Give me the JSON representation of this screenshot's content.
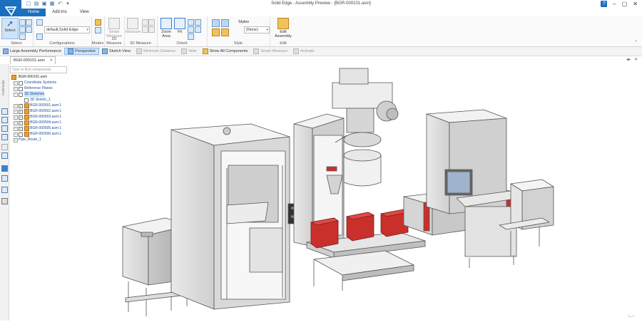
{
  "window": {
    "title": "Solid Edge - Assembly Preview - [BGR-000101.asm]"
  },
  "tabs": [
    "Home",
    "Add-Ins",
    "View"
  ],
  "ribbon": {
    "select": {
      "label": "Select",
      "group": "Select"
    },
    "configurations": {
      "value": "default,Solid Edge",
      "group": "Configurations"
    },
    "modes": {
      "group": "Modes"
    },
    "measure2d": {
      "label": "Smart Measure",
      "group": "2D Measure"
    },
    "measure3d": {
      "label": "Measure",
      "group": "3D Measure"
    },
    "orient": {
      "zoom_label": "Zoom Area",
      "fit_label": "Fit",
      "group": "Orient"
    },
    "style": {
      "styles_label": "Styles",
      "styles_value": "(None)",
      "group": "Style"
    },
    "edit": {
      "label": "Edit Assembly",
      "group": "Edit"
    }
  },
  "command_bar": {
    "large_assembly": "Large Assembly Performance",
    "perspective": "Perspective",
    "sketch_view": "Sketch View",
    "minimum_distance": "Minimum Distance",
    "hide": "Hide",
    "show_all": "Show All Components",
    "smart_measure": "Smart Measure",
    "activate": "Activate"
  },
  "document_tab": "BGR-000101.asm",
  "pathfinder": {
    "filter_placeholder": "Type to find components",
    "side_label": "PathFinder",
    "items": [
      {
        "label": "BGR-000101.asm"
      },
      {
        "label": "Coordinate Systems"
      },
      {
        "label": "Reference Planes"
      },
      {
        "label": "3D Sketches"
      },
      {
        "label": "3D Sketch_1"
      },
      {
        "label": "BGR-000501.asm:1"
      },
      {
        "label": "BGR-000502.asm:1"
      },
      {
        "label": "BGR-000503.asm:1"
      },
      {
        "label": "BGR-000504.asm:1"
      },
      {
        "label": "BGR-000505.asm:1"
      },
      {
        "label": "BGR-000500.asm:1"
      },
      {
        "label": "Pipe_Route_1"
      }
    ]
  },
  "colors": {
    "accent": "#1a6fbf",
    "tree_link": "#1f4e9b",
    "bin_red": "#c9302c"
  }
}
